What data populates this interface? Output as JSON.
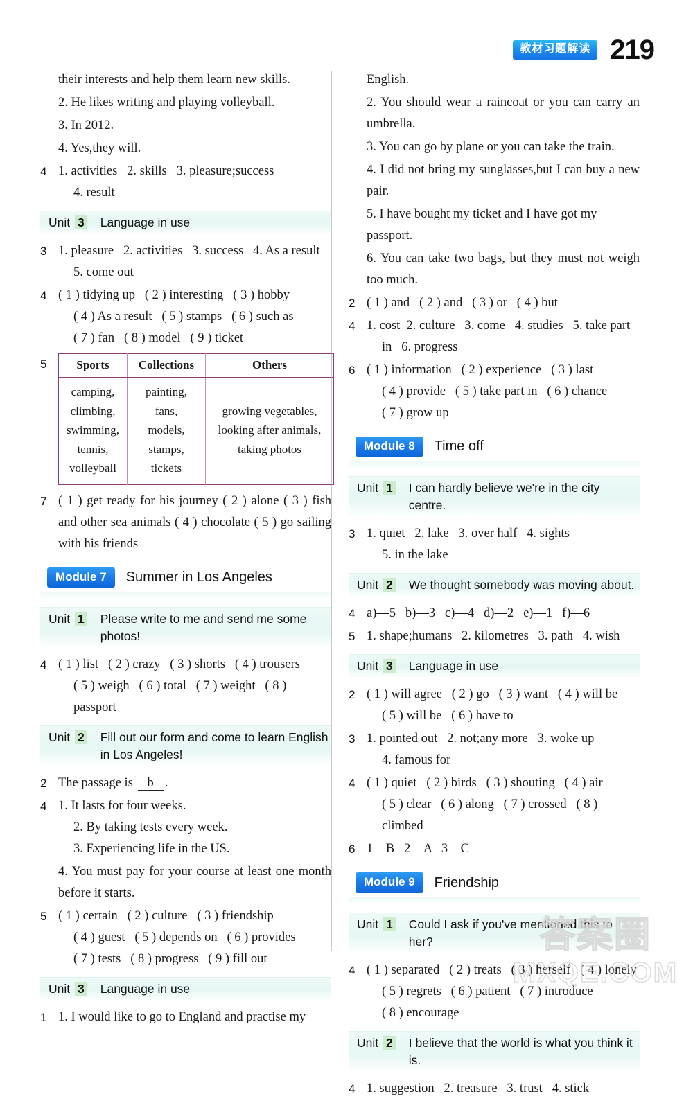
{
  "header": {
    "badge_cn": "教材习题解读",
    "page_number": "219",
    "badge_color": "#1b8ff0"
  },
  "left_column": {
    "blocks": [
      {
        "kind": "cont",
        "lines": [
          "their interests and help them learn new skills."
        ]
      },
      {
        "kind": "cont",
        "lines": [
          "2. He likes writing and playing volleyball."
        ]
      },
      {
        "kind": "cont",
        "lines": [
          "3. In 2012."
        ]
      },
      {
        "kind": "cont",
        "lines": [
          "4. Yes,they will."
        ]
      },
      {
        "kind": "q",
        "num": "4",
        "lines": [
          "1. activities   2. skills   3. pleasure;success",
          "4. result"
        ]
      },
      {
        "kind": "unit",
        "label": "Unit",
        "no": "3",
        "title": "Language in use"
      },
      {
        "kind": "q",
        "num": "3",
        "lines": [
          "1. pleasure   2. activities   3. success   4. As a result",
          "5. come out"
        ]
      },
      {
        "kind": "q",
        "num": "4",
        "lines": [
          "( 1 ) tidying up   ( 2 ) interesting   ( 3 ) hobby",
          "( 4 ) As a result   ( 5 ) stamps   ( 6 ) such as",
          "( 7 ) fan   ( 8 ) model   ( 9 ) ticket"
        ]
      },
      {
        "kind": "table",
        "num": "5"
      },
      {
        "kind": "q",
        "num": "7",
        "justify": true,
        "lines": [
          "( 1 ) get ready for his journey   ( 2 ) alone   ( 3 ) fish and other sea animals   ( 4 ) chocolate   ( 5 ) go sailing with his friends"
        ]
      },
      {
        "kind": "module",
        "label": "Module 7",
        "title": "Summer in Los Angeles"
      },
      {
        "kind": "unit",
        "label": "Unit",
        "no": "1",
        "title": "Please write to me and send me some photos!"
      },
      {
        "kind": "q",
        "num": "4",
        "lines": [
          "( 1 ) list   ( 2 ) crazy   ( 3 ) shorts   ( 4 ) trousers",
          "( 5 ) weigh   ( 6 ) total   ( 7 ) weight   ( 8 ) passport"
        ]
      },
      {
        "kind": "unit",
        "label": "Unit",
        "no": "2",
        "title": "Fill out our form and come to learn English in Los Angeles!"
      },
      {
        "kind": "blank",
        "num": "2",
        "before": "The passage is ",
        "answer": "b",
        "after": "."
      },
      {
        "kind": "q",
        "num": "4",
        "lines": [
          "1. It lasts for four weeks.",
          "2. By taking tests every week.",
          "3. Experiencing life in the US."
        ]
      },
      {
        "kind": "q",
        "num": "",
        "justify": true,
        "lines": [
          "4. You must pay for your course at least one month before it starts."
        ]
      },
      {
        "kind": "q",
        "num": "5",
        "lines": [
          "( 1 ) certain   ( 2 ) culture   ( 3 ) friendship",
          "( 4 ) guest   ( 5 ) depends on   ( 6 ) provides",
          "( 7 ) tests   ( 8 ) progress   ( 9 ) fill out"
        ]
      },
      {
        "kind": "unit",
        "label": "Unit",
        "no": "3",
        "title": "Language in use"
      },
      {
        "kind": "q",
        "num": "1",
        "justify": true,
        "lines": [
          "1. I would like to go to England and practise my"
        ]
      }
    ],
    "table": {
      "headers": [
        "Sports",
        "Collections",
        "Others"
      ],
      "cells": [
        "camping,\nclimbing,\nswimming,\ntennis,\nvolleyball",
        "painting,\nfans,\nmodels,\nstamps,\ntickets",
        "growing vegetables,\nlooking after animals,\ntaking photos"
      ]
    }
  },
  "right_column": {
    "blocks": [
      {
        "kind": "cont",
        "lines": [
          "English."
        ]
      },
      {
        "kind": "cont",
        "justify": true,
        "lines": [
          "2. You should wear a raincoat or you can carry an umbrella."
        ]
      },
      {
        "kind": "cont",
        "lines": [
          "3. You can go by plane or you can take the train."
        ]
      },
      {
        "kind": "cont",
        "justify": true,
        "lines": [
          "4. I did not bring my sunglasses,but I can buy a new pair."
        ]
      },
      {
        "kind": "cont",
        "lines": [
          "5. I have bought my ticket and I have got my passport."
        ]
      },
      {
        "kind": "cont",
        "justify": true,
        "lines": [
          "6. You can take two bags, but they must not weigh too much."
        ]
      },
      {
        "kind": "q",
        "num": "2",
        "lines": [
          "( 1 ) and   ( 2 ) and   ( 3 ) or   ( 4 ) but"
        ]
      },
      {
        "kind": "q",
        "num": "4",
        "lines": [
          "1. cost  2. culture   3. come   4. studies   5. take part",
          "in   6. progress"
        ]
      },
      {
        "kind": "q",
        "num": "6",
        "lines": [
          "( 1 ) information   ( 2 ) experience   ( 3 ) last",
          "( 4 ) provide   ( 5 ) take part in   ( 6 ) chance",
          "( 7 ) grow up"
        ]
      },
      {
        "kind": "module",
        "label": "Module 8",
        "title": "Time off"
      },
      {
        "kind": "unit",
        "label": "Unit",
        "no": "1",
        "title": "I can hardly believe we're in the city centre."
      },
      {
        "kind": "q",
        "num": "3",
        "lines": [
          "1. quiet   2. lake   3. over half   4. sights",
          "5. in the lake"
        ]
      },
      {
        "kind": "unit",
        "label": "Unit",
        "no": "2",
        "title": "We thought somebody was moving about."
      },
      {
        "kind": "q",
        "num": "4",
        "lines": [
          "a)—5   b)—3   c)—4   d)—2   e)—1   f)—6"
        ]
      },
      {
        "kind": "q",
        "num": "5",
        "lines": [
          "1. shape;humans   2. kilometres   3. path   4. wish"
        ]
      },
      {
        "kind": "unit",
        "label": "Unit",
        "no": "3",
        "title": "Language in use"
      },
      {
        "kind": "q",
        "num": "2",
        "lines": [
          "( 1 ) will agree   ( 2 ) go   ( 3 ) want   ( 4 ) will be",
          "( 5 ) will be   ( 6 ) have to"
        ]
      },
      {
        "kind": "q",
        "num": "3",
        "lines": [
          "1. pointed out   2. not;any more   3. woke up",
          "4. famous for"
        ]
      },
      {
        "kind": "q",
        "num": "4",
        "lines": [
          "( 1 ) quiet   ( 2 ) birds   ( 3 ) shouting   ( 4 ) air",
          "( 5 ) clear   ( 6 ) along   ( 7 ) crossed   ( 8 ) climbed"
        ]
      },
      {
        "kind": "q",
        "num": "6",
        "lines": [
          "1—B   2—A   3—C"
        ]
      },
      {
        "kind": "module",
        "label": "Module 9",
        "title": "Friendship"
      },
      {
        "kind": "unit",
        "label": "Unit",
        "no": "1",
        "title": "Could I ask if you've mentioned this to her?"
      },
      {
        "kind": "q",
        "num": "4",
        "lines": [
          "( 1 ) separated   ( 2 ) treats   ( 3 ) herself   ( 4 ) lonely",
          "( 5 ) regrets   ( 6 ) patient   ( 7 ) introduce",
          "( 8 ) encourage"
        ]
      },
      {
        "kind": "unit",
        "label": "Unit",
        "no": "2",
        "title": "I believe that the world is what you think it is."
      },
      {
        "kind": "q",
        "num": "4",
        "lines": [
          "1. suggestion   2. treasure   3. trust   4. stick"
        ]
      }
    ]
  },
  "watermark": {
    "cn": "答案圈",
    "en": "MXQE.COM"
  }
}
